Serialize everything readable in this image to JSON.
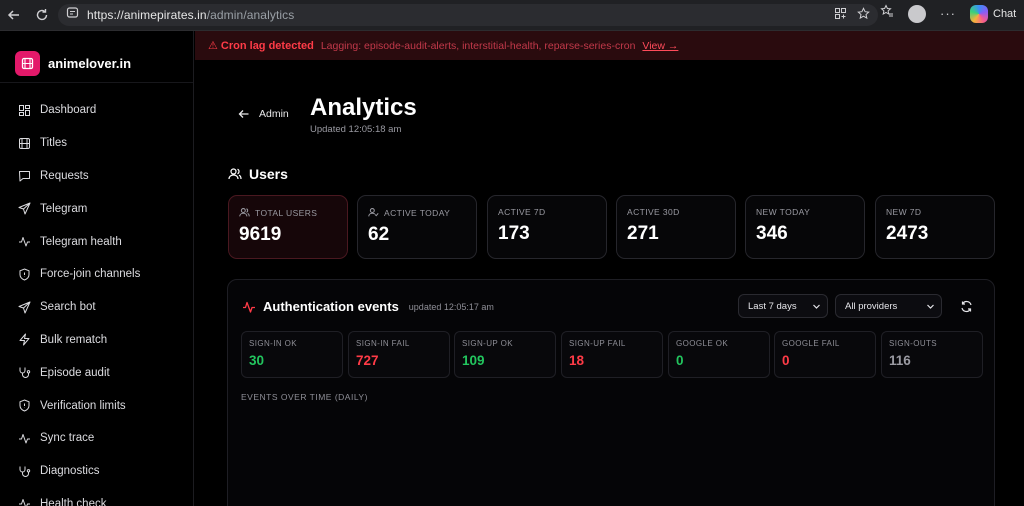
{
  "browser": {
    "url_host": "https://animepirates.in",
    "url_path": "/admin/analytics",
    "chat_label": "Chat"
  },
  "sidebar": {
    "brand": "animelover.in",
    "items": [
      {
        "label": "Dashboard",
        "icon": "grid-icon"
      },
      {
        "label": "Titles",
        "icon": "film-icon"
      },
      {
        "label": "Requests",
        "icon": "message-icon"
      },
      {
        "label": "Telegram",
        "icon": "send-icon"
      },
      {
        "label": "Telegram health",
        "icon": "activity-icon"
      },
      {
        "label": "Force-join channels",
        "icon": "shield-icon"
      },
      {
        "label": "Search bot",
        "icon": "send-icon"
      },
      {
        "label": "Bulk rematch",
        "icon": "zap-icon"
      },
      {
        "label": "Episode audit",
        "icon": "stethoscope-icon"
      },
      {
        "label": "Verification limits",
        "icon": "shield-icon"
      },
      {
        "label": "Sync trace",
        "icon": "activity-icon"
      },
      {
        "label": "Diagnostics",
        "icon": "stethoscope-icon"
      },
      {
        "label": "Health check",
        "icon": "activity-icon"
      }
    ]
  },
  "alert": {
    "title": "⚠ Cron lag detected",
    "message": "Lagging: episode-audit-alerts, interstitial-health, reparse-series-cron",
    "link": "View →"
  },
  "header": {
    "back_label": "Admin",
    "title": "Analytics",
    "updated": "Updated 12:05:18 am"
  },
  "users": {
    "heading": "Users",
    "stats": [
      {
        "label": "TOTAL USERS",
        "value": "9619",
        "icon": "users-icon"
      },
      {
        "label": "ACTIVE TODAY",
        "value": "62",
        "icon": "user-check-icon"
      },
      {
        "label": "ACTIVE 7D",
        "value": "173"
      },
      {
        "label": "ACTIVE 30D",
        "value": "271"
      },
      {
        "label": "NEW TODAY",
        "value": "346"
      },
      {
        "label": "NEW 7D",
        "value": "2473"
      }
    ]
  },
  "auth": {
    "title": "Authentication events",
    "updated": "updated 12:05:17 am",
    "range": "Last 7 days",
    "provider": "All providers",
    "stats": [
      {
        "label": "SIGN-IN OK",
        "value": "30",
        "color": "#22c55e"
      },
      {
        "label": "SIGN-IN FAIL",
        "value": "727",
        "color": "#ff3b47"
      },
      {
        "label": "SIGN-UP OK",
        "value": "109",
        "color": "#22c55e"
      },
      {
        "label": "SIGN-UP FAIL",
        "value": "18",
        "color": "#ff3b47"
      },
      {
        "label": "GOOGLE OK",
        "value": "0",
        "color": "#22c55e"
      },
      {
        "label": "GOOGLE FAIL",
        "value": "0",
        "color": "#ff3b47"
      },
      {
        "label": "SIGN-OUTS",
        "value": "116",
        "color": "#9a9aa2"
      }
    ],
    "chart_label": "EVENTS OVER TIME (DAILY)"
  }
}
